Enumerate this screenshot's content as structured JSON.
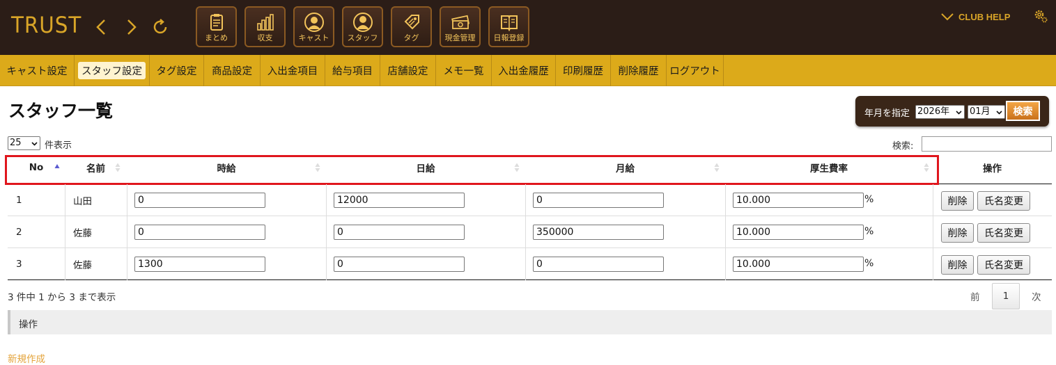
{
  "header": {
    "logo": "TRUST",
    "club_help": "CLUB HELP",
    "icon_buttons": [
      {
        "label": "まとめ",
        "icon": "clipboard-icon"
      },
      {
        "label": "収支",
        "icon": "bar-chart-icon"
      },
      {
        "label": "キャスト",
        "icon": "cast-person-icon"
      },
      {
        "label": "スタッフ",
        "icon": "staff-person-icon"
      },
      {
        "label": "タグ",
        "icon": "tag-icon"
      },
      {
        "label": "現金管理",
        "icon": "cash-icon"
      },
      {
        "label": "日報登録",
        "icon": "book-icon"
      }
    ]
  },
  "menu": {
    "items": [
      "キャスト設定",
      "スタッフ設定",
      "タグ設定",
      "商品設定",
      "入出金項目",
      "給与項目",
      "店舗設定",
      "メモ一覧",
      "入出金履歴",
      "印刷履歴",
      "削除履歴",
      "ログアウト"
    ],
    "active": "スタッフ設定"
  },
  "page": {
    "title": "スタッフ一覧"
  },
  "month_filter": {
    "label": "年月を指定",
    "year": "2026年",
    "month": "01月",
    "search_button": "検索"
  },
  "table_controls": {
    "page_length": "25",
    "page_length_suffix": "件表示",
    "search_label": "検索:",
    "search_value": ""
  },
  "table": {
    "columns": [
      "No",
      "名前",
      "時給",
      "日給",
      "月給",
      "厚生費率",
      "操作"
    ],
    "rows": [
      {
        "no": "1",
        "name": "山田",
        "hourly": "0",
        "daily": "12000",
        "monthly": "0",
        "welfare_rate": "10.000",
        "pct": "%"
      },
      {
        "no": "2",
        "name": "佐藤",
        "hourly": "0",
        "daily": "0",
        "monthly": "350000",
        "welfare_rate": "10.000",
        "pct": "%"
      },
      {
        "no": "3",
        "name": "佐藤",
        "hourly": "1300",
        "daily": "0",
        "monthly": "0",
        "welfare_rate": "10.000",
        "pct": "%"
      }
    ],
    "delete_label": "削除",
    "rename_label": "氏名変更"
  },
  "footer": {
    "info": "3 件中 1 から 3 まで表示",
    "prev": "前",
    "current_page": "1",
    "next": "次",
    "ops_label": "操作",
    "new_link": "新規作成"
  },
  "colors": {
    "header_bg": "#2b1d17",
    "gold": "#d9a528",
    "menu_bg": "#dcaa1a",
    "highlight": "#e0161d",
    "link": "#e4a43c"
  }
}
